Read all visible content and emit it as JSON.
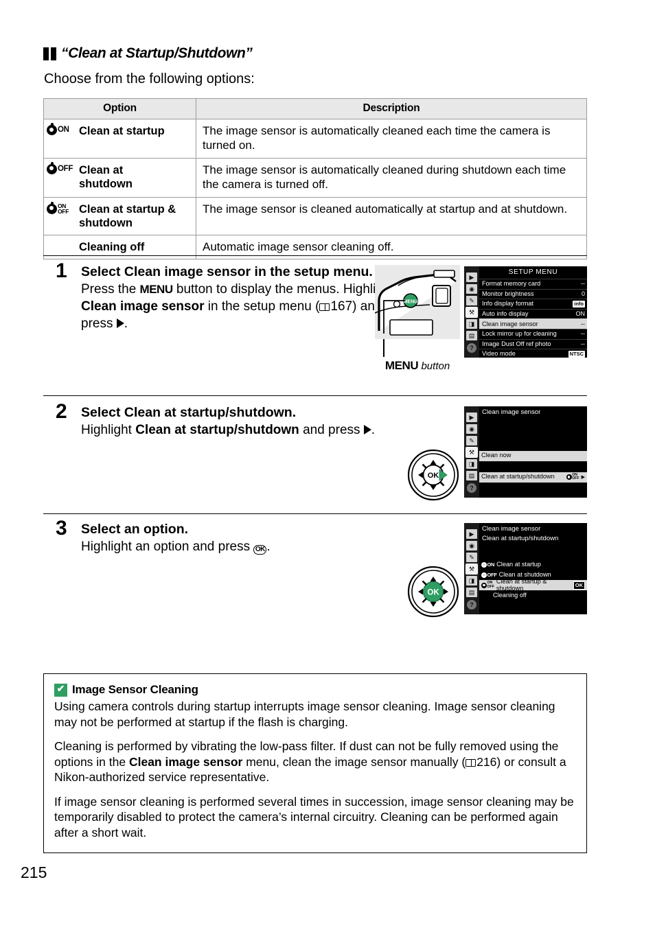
{
  "section": {
    "title": "“Clean at Startup/Shutdown”",
    "lead": "Choose from the following options:"
  },
  "table": {
    "headers": [
      "Option",
      "Description"
    ],
    "rows": [
      {
        "icon": "sensor-clean-on-icon",
        "icon_text": "ON",
        "option": "Clean at startup",
        "description": "The image sensor is automatically cleaned each time the camera is turned on."
      },
      {
        "icon": "sensor-clean-off-icon",
        "icon_text": "OFF",
        "option": "Clean at shutdown",
        "description": "The image sensor is automatically cleaned during shutdown each time the camera is turned off."
      },
      {
        "icon": "sensor-clean-onoff-icon",
        "icon_text_top": "ON",
        "icon_text_bottom": "OFF",
        "option": "Clean at startup & shutdown",
        "description": "The image sensor is cleaned automatically at startup and at shutdown."
      },
      {
        "icon": "",
        "icon_text": "",
        "option": "Cleaning off",
        "description": "Automatic image sensor cleaning off."
      }
    ]
  },
  "steps": [
    {
      "number": "1",
      "title_a": "Select ",
      "title_b": "Clean image sensor",
      "title_c": " in the setup menu.",
      "text_1a": "Press the ",
      "text_1b": "MENU",
      "text_1c": " button to display the menus.",
      "text_2a": "Highlight ",
      "text_2b": "Clean image sensor",
      "text_2c": " in the setup menu (",
      "page_ref": "167",
      "text_2d": ") and press ",
      "text_2e": "."
    },
    {
      "number": "2",
      "title_a": "Select ",
      "title_b": "Clean at startup/shutdown",
      "title_c": ".",
      "text_1a": "Highlight ",
      "text_1b": "Clean at startup/shutdown",
      "text_1c": " and press ",
      "text_1d": "."
    },
    {
      "number": "3",
      "title_a": "Select an option.",
      "text_1a": "Highlight an option and press ",
      "text_1b": "OK",
      "text_1c": "."
    }
  ],
  "camera_figure": {
    "caption_button": "MENU",
    "caption_word": " button"
  },
  "lcd_setup_menu": {
    "title": "SETUP MENU",
    "sidebar_icons": [
      "playback-icon",
      "shooting-menu-icon",
      "custom-settings-icon",
      "setup-menu-icon",
      "retouch-menu-icon",
      "recent-settings-icon"
    ],
    "sidebar_selected_index": 3,
    "help_label": "?",
    "items": [
      {
        "label": "Format memory card",
        "value": "--",
        "highlighted": false
      },
      {
        "label": "Monitor brightness",
        "value": "0",
        "highlighted": false
      },
      {
        "label": "Info display format",
        "value": "info",
        "badge": true,
        "highlighted": false
      },
      {
        "label": "Auto info display",
        "value": "ON",
        "highlighted": false
      },
      {
        "label": "Clean image sensor",
        "value": "--",
        "highlighted": true
      },
      {
        "label": "Lock mirror up for cleaning",
        "value": "--",
        "highlighted": false
      },
      {
        "label": "Image Dust Off ref photo",
        "value": "--",
        "highlighted": false
      },
      {
        "label": "Video mode",
        "value": "NTSC",
        "badge": true,
        "highlighted": false
      }
    ]
  },
  "lcd_clean_image_sensor": {
    "title": "Clean image sensor",
    "help_label": "?",
    "items": [
      {
        "label": "Clean now",
        "highlighted": false,
        "dim": true
      },
      {
        "label": "Clean at startup/shutdown",
        "highlighted": true,
        "icon": "sensor-clean-onoff-icon",
        "arrow": "▶"
      }
    ]
  },
  "lcd_startup_shutdown": {
    "title": "Clean image sensor",
    "subtitle": "Clean at startup/shutdown",
    "help_label": "?",
    "items": [
      {
        "label": "Clean at startup",
        "icon_text": "ON",
        "highlighted": false
      },
      {
        "label": "Clean at shutdown",
        "icon_text": "OFF",
        "highlighted": false
      },
      {
        "label": "Clean at startup & shutdown",
        "icon_text_top": "ON",
        "icon_text_bottom": "OFF",
        "highlighted": true,
        "badge": "OK"
      },
      {
        "label": "Cleaning off",
        "highlighted": false
      }
    ]
  },
  "dials": {
    "step2": {
      "name": "multi-selector-right",
      "highlight": "right-arrow",
      "center_label": "OK"
    },
    "step3": {
      "name": "multi-selector-ok",
      "highlight": "ok-center",
      "center_label": "OK"
    }
  },
  "note": {
    "icon": "caution-check-icon",
    "icon_glyph": "✔",
    "title": "Image Sensor Cleaning",
    "paragraph_1": "Using camera controls during startup interrupts image sensor cleaning.  Image sensor cleaning may not be performed at startup if the flash is charging.",
    "p2_a": "Cleaning is performed by vibrating the low-pass filter.  If dust can not be fully removed using the options in the ",
    "p2_b": "Clean image sensor",
    "p2_c": " menu, clean the image sensor manually (",
    "p2_ref": "216",
    "p2_d": ") or consult a Nikon-authorized service representative.",
    "paragraph_3": "If image sensor cleaning is performed several times in succession, image sensor cleaning may be temporarily disabled to protect the camera’s internal circuitry.  Cleaning can be performed again after a short wait."
  },
  "page_number": "215",
  "colors": {
    "accent_green": "#2f9e63",
    "header_gray": "#e8e8e8",
    "lcd_highlight": "#d9d9d9"
  }
}
